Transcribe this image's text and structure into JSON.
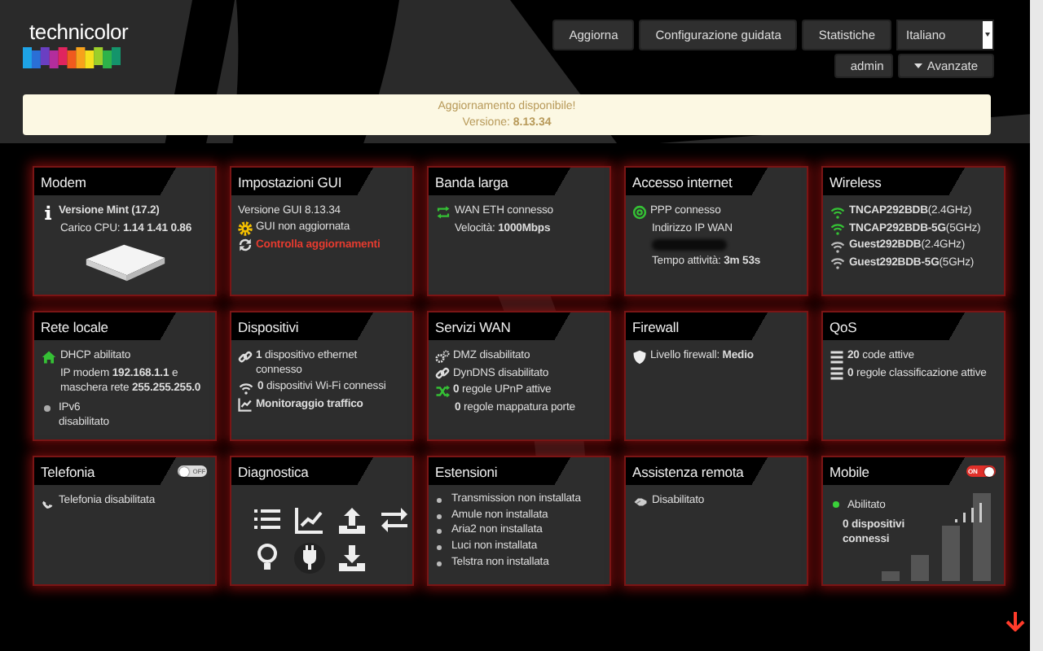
{
  "header": {
    "logo": "technicolor",
    "buttons": [
      "Aggiorna",
      "Configurazione guidata",
      "Statistiche"
    ],
    "language": "Italiano",
    "user": "admin",
    "advanced": "Avanzate"
  },
  "banner": {
    "title": "Aggiornamento disponibile!",
    "version": "Versione: **8.13.34**"
  },
  "cards": [
    {
      "title": "Modem",
      "kind": "modem",
      "lines": [
        {
          "kind": "icon",
          "text": "**Versione Mint (17.2)**"
        },
        {
          "kind": "indent",
          "text": "Carico CPU: **1.14 1.41 0.86**"
        }
      ]
    },
    {
      "title": "Impostazioni GUI",
      "kind": "lines",
      "lines": [
        {
          "kind": "plain",
          "text": "Versione GUI 8.13.34"
        },
        {
          "kind": "icon",
          "text": "GUI non aggiornata"
        },
        {
          "kind": "link",
          "text": "Controlla aggiornamenti"
        }
      ]
    },
    {
      "title": "Banda larga",
      "kind": "lines",
      "lines": [
        {
          "kind": "icon",
          "text": "WAN ETH connesso"
        },
        {
          "kind": "indent",
          "text": "Velocità: **1000Mbps**"
        }
      ]
    },
    {
      "title": "Accesso internet",
      "kind": "lines",
      "lines": [
        {
          "kind": "icon",
          "text": "PPP connesso"
        },
        {
          "kind": "indent",
          "text": "Indirizzo IP WAN"
        },
        {
          "kind": "masked"
        },
        {
          "kind": "indent",
          "text": "Tempo attività: **3m 53s**"
        }
      ]
    },
    {
      "title": "Wireless",
      "kind": "lines",
      "lines": [
        {
          "kind": "wifi",
          "enabled": true,
          "text": "**TNCAP292BDB**(2.4GHz)"
        },
        {
          "kind": "wifi",
          "enabled": true,
          "text": "**TNCAP292BDB-5G**(5GHz)"
        },
        {
          "kind": "wifi",
          "enabled": false,
          "text": "**Guest292BDB**(2.4GHz)"
        },
        {
          "kind": "wifi",
          "enabled": false,
          "text": "**Guest292BDB-5G**(5GHz)"
        }
      ]
    },
    {
      "title": "Rete locale",
      "kind": "lines",
      "lines": [
        {
          "kind": "icon",
          "text": "DHCP abilitato"
        },
        {
          "kind": "indent",
          "text": "IP modem **192.168.1.1** e maschera rete **255.255.255.0**"
        },
        {
          "kind": "dot",
          "enabled": false,
          "text": "IPv6 disabilitato"
        }
      ]
    },
    {
      "title": "Dispositivi",
      "kind": "lines",
      "lines": [
        {
          "kind": "icon",
          "text": "**1** dispositivo ethernet connesso"
        },
        {
          "kind": "icon",
          "text": "**0** dispositivi Wi-Fi connessi"
        },
        {
          "kind": "iconlink",
          "text": "Monitoraggio traffico"
        }
      ]
    },
    {
      "title": "Servizi WAN",
      "kind": "lines",
      "lines": [
        {
          "kind": "icon",
          "text": "DMZ disabilitato"
        },
        {
          "kind": "icon",
          "text": "DynDNS disabilitato"
        },
        {
          "kind": "icon",
          "text": "**0** regole UPnP attive"
        },
        {
          "kind": "indent",
          "text": "**0** regole mappatura porte"
        }
      ]
    },
    {
      "title": "Firewall",
      "kind": "lines",
      "lines": [
        {
          "kind": "icon",
          "text": "Livello firewall: **Medio**"
        }
      ]
    },
    {
      "title": "QoS",
      "kind": "lines",
      "lines": [
        {
          "kind": "icon",
          "text": "**20** code attive"
        },
        {
          "kind": "icon",
          "text": "**0** regole classificazione attive"
        }
      ]
    },
    {
      "title": "Telefonia",
      "kind": "lines",
      "toggle": {
        "on": false,
        "label": "OFF"
      },
      "lines": [
        {
          "kind": "icon",
          "text": "Telefonia disabilitata"
        }
      ]
    },
    {
      "title": "Diagnostica",
      "kind": "tools"
    },
    {
      "title": "Estensioni",
      "kind": "lines",
      "lines": [
        {
          "kind": "bullet",
          "text": "Transmission non installata"
        },
        {
          "kind": "bullet",
          "text": "Amule non installata"
        },
        {
          "kind": "bullet",
          "text": "Aria2 non installata"
        },
        {
          "kind": "bullet",
          "text": "Luci non installata"
        },
        {
          "kind": "bullet",
          "text": "Telstra non installata"
        }
      ]
    },
    {
      "title": "Assistenza remota",
      "kind": "lines",
      "lines": [
        {
          "kind": "icon",
          "text": "Disabilitato"
        }
      ]
    },
    {
      "title": "Mobile",
      "kind": "mobile",
      "toggle": {
        "on": true,
        "label": "ON"
      },
      "lines": [
        {
          "kind": "dot",
          "enabled": true,
          "text": "Abilitato"
        },
        {
          "kind": "bold",
          "text": "0 dispositivi connessi"
        }
      ]
    }
  ]
}
